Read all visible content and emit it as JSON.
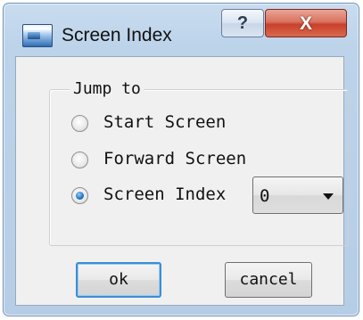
{
  "window": {
    "title": "Screen Index",
    "icon": "app-window-icon",
    "help_label": "?",
    "close_label": "X"
  },
  "jump_group": {
    "legend": "Jump to",
    "options": [
      {
        "label": "Start Screen",
        "checked": false
      },
      {
        "label": "Forward Screen",
        "checked": false
      },
      {
        "label": "Screen Index",
        "checked": true
      }
    ],
    "screen_index_value": "0"
  },
  "buttons": {
    "ok_label": "ok",
    "cancel_label": "cancel"
  },
  "colors": {
    "title_bar": "#bcd3ea",
    "close_button": "#c8402a",
    "default_button_border": "#3b8ed6"
  }
}
